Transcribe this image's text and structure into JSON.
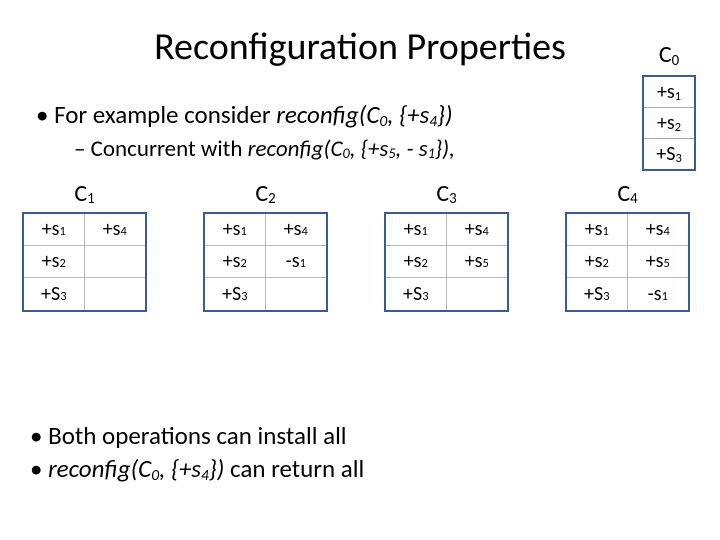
{
  "title_a": "Reconfiguration Properties",
  "b1_a": "• For example consider ",
  "b1_b": "reconfig(C",
  "b1_c": "0",
  "b1_d": ", ",
  "b1_e": "{+s",
  "b1_f": "4",
  "b1_g": "})",
  "b2_a": "– Concurrent with ",
  "b2_b": "reconfig(C",
  "b2_c": "0",
  "b2_d": ", ",
  "b2_e": "{+s",
  "b2_f": "5",
  "b2_g": ", - s",
  "b2_h": "1",
  "b2_i": "}),",
  "c0_lab_a": "C",
  "c0_lab_b": "0",
  "c0_r1a": "+s",
  "c0_r1b": "1",
  "c0_r2a": "+s",
  "c0_r2b": "2",
  "c0_r3a": "+S",
  "c0_r3b": "3",
  "cfg1_lab_a": "C",
  "cfg1_lab_b": "1",
  "g1_1a": "+s",
  "g1_1b": "1",
  "g1_2a": "+s",
  "g1_2b": "4",
  "g1_3a": "+s",
  "g1_3b": "2",
  "g1_4": "",
  "g1_5a": "+S",
  "g1_5b": "3",
  "g1_6": "",
  "cfg2_lab_a": "C",
  "cfg2_lab_b": "2",
  "g2_1a": "+s",
  "g2_1b": "1",
  "g2_2a": "+s",
  "g2_2b": "4",
  "g2_3a": "+s",
  "g2_3b": "2",
  "g2_4a": "-s",
  "g2_4b": "1",
  "g2_5a": "+S",
  "g2_5b": "3",
  "g2_6": "",
  "cfg3_lab_a": "C",
  "cfg3_lab_b": "3",
  "g3_1a": "+s",
  "g3_1b": "1",
  "g3_2a": "+s",
  "g3_2b": "4",
  "g3_3a": "+s",
  "g3_3b": "2",
  "g3_4a": "+s",
  "g3_4b": "5",
  "g3_5a": "+S",
  "g3_5b": "3",
  "g3_6": "",
  "cfg4_lab_a": "C",
  "cfg4_lab_b": "4",
  "g4_1a": "+s",
  "g4_1b": "1",
  "g4_2a": "+s",
  "g4_2b": "4",
  "g4_3a": "+s",
  "g4_3b": "2",
  "g4_4a": "+s",
  "g4_4b": "5",
  "g4_5a": "+S",
  "g4_5b": "3",
  "g4_6a": "-s",
  "g4_6b": "1",
  "bb1": "• Both operations can install all",
  "bb2_a": "• ",
  "bb2_b": "reconfig(C",
  "bb2_c": "0",
  "bb2_d": ", ",
  "bb2_e": "{+s",
  "bb2_f": "4",
  "bb2_g": "}) ",
  "bb2_h": "can return all"
}
